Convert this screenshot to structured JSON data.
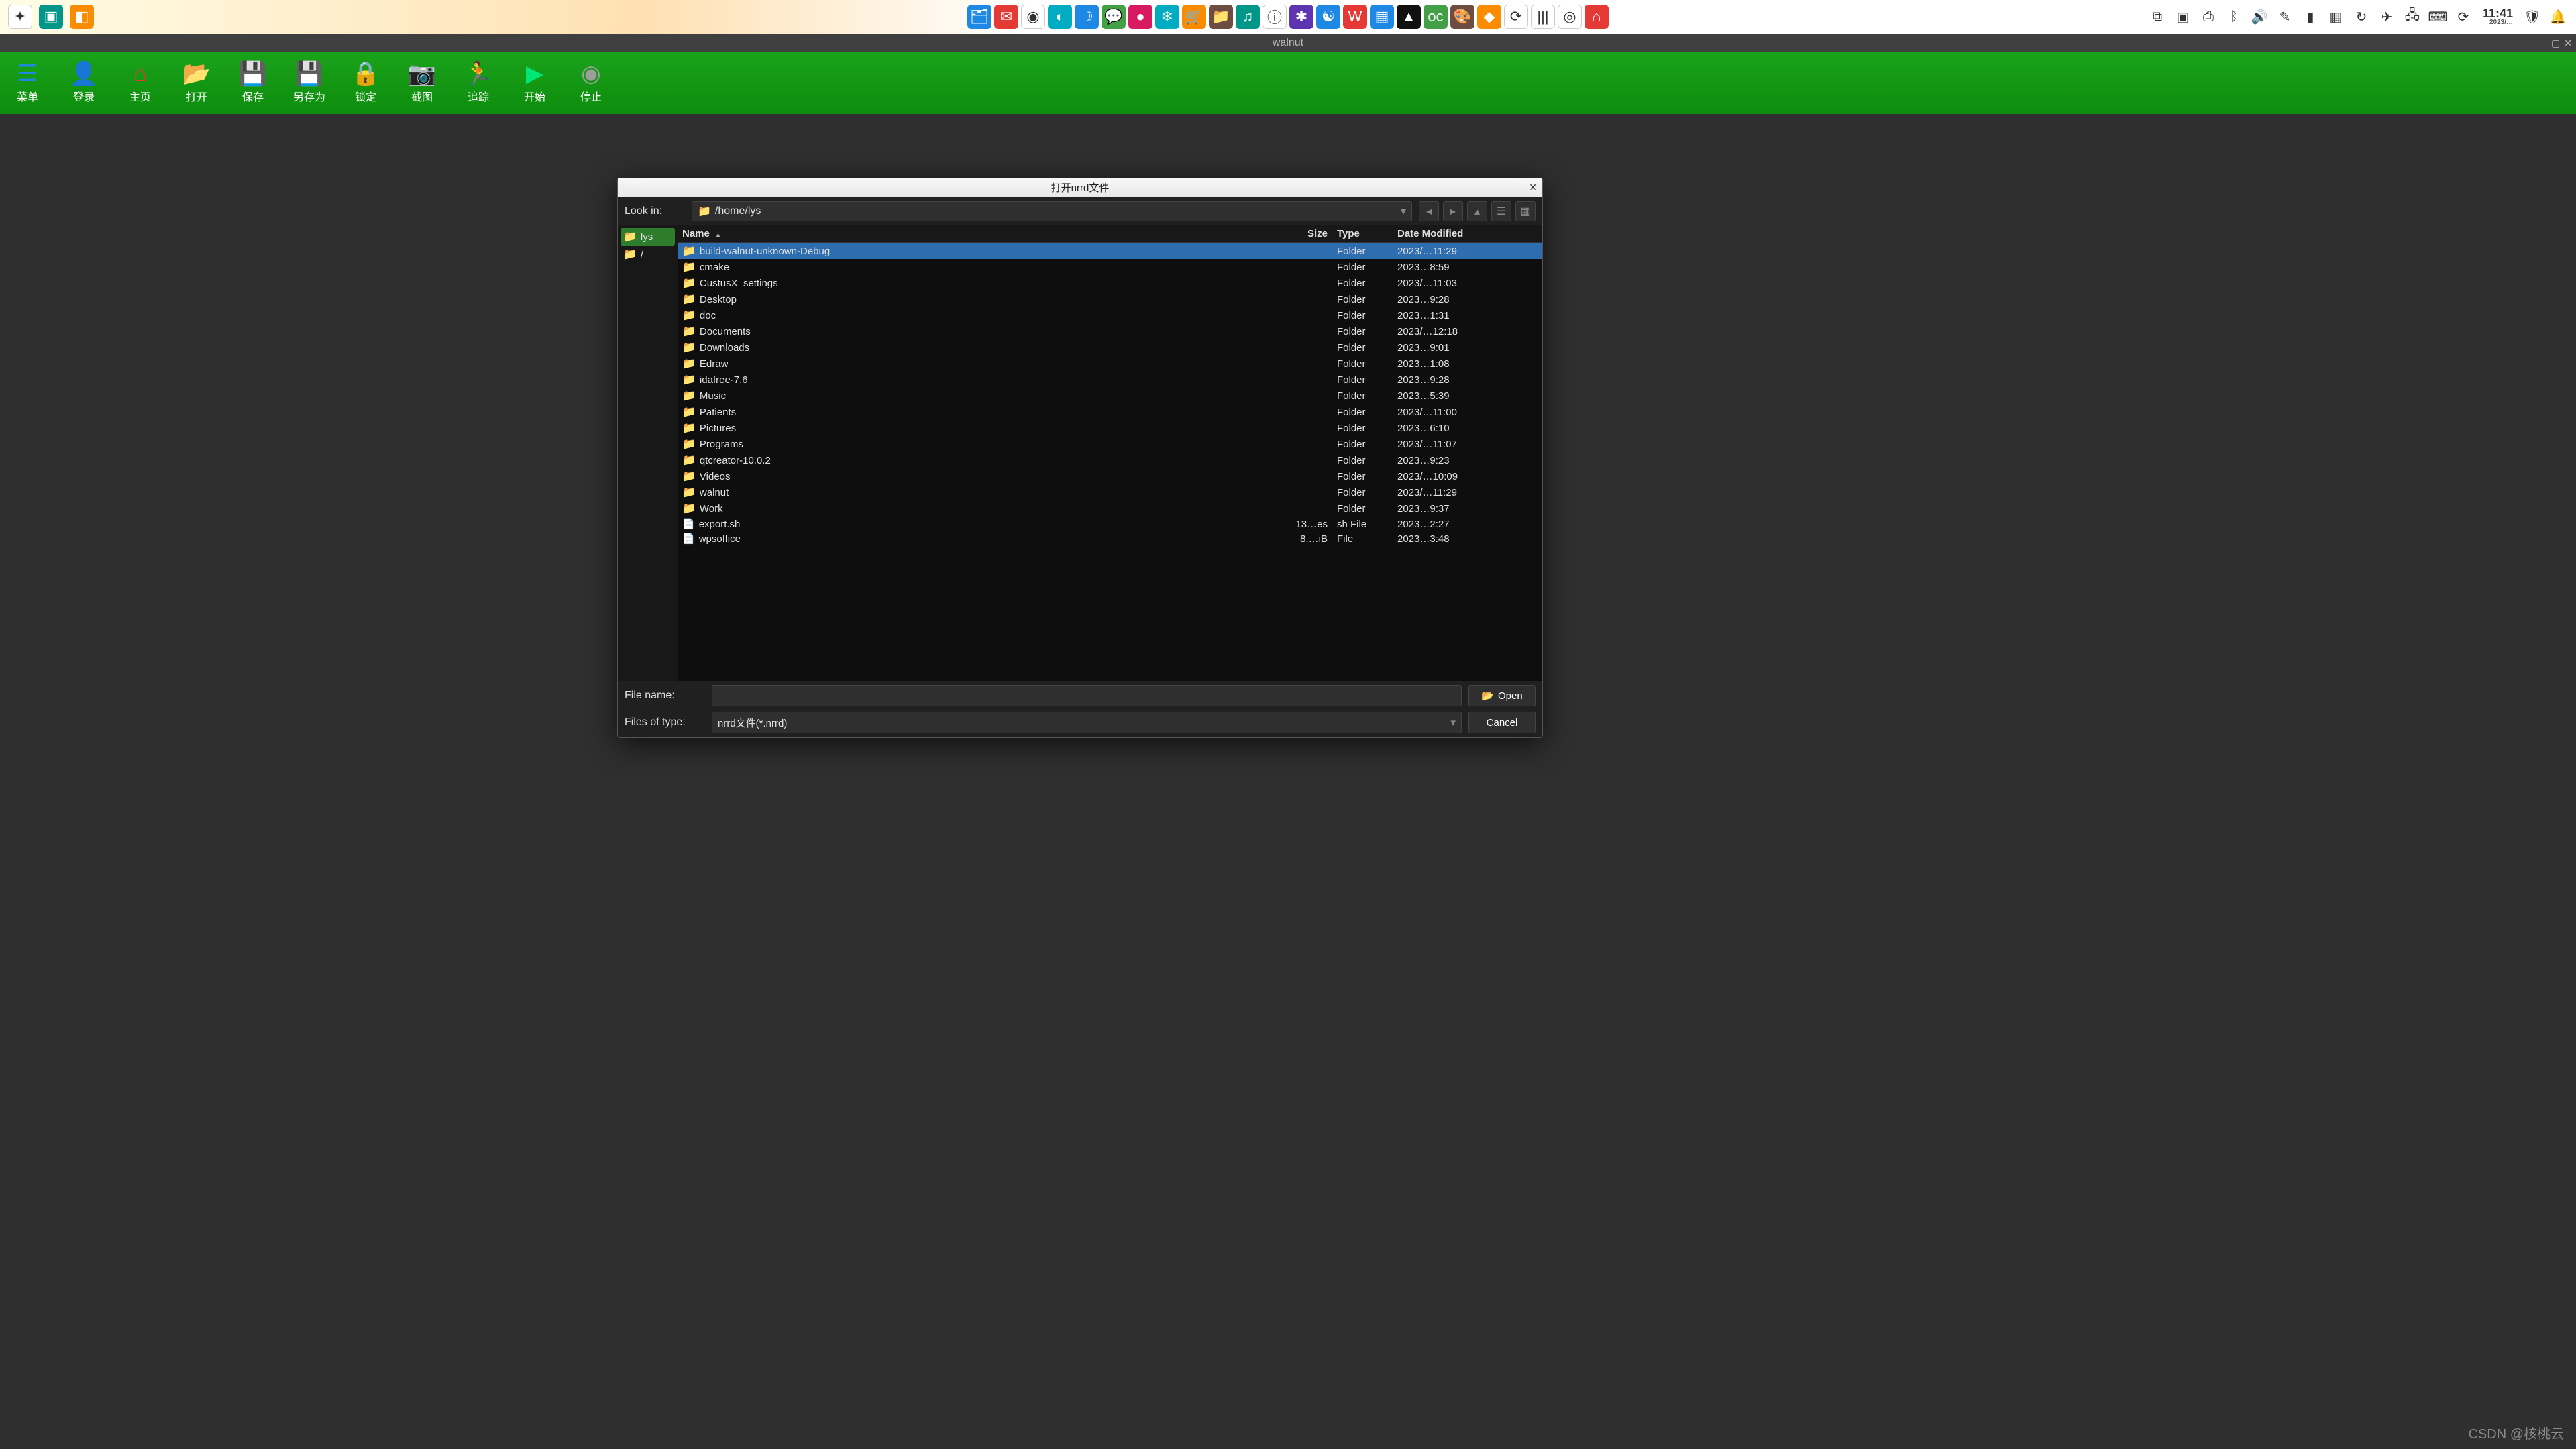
{
  "sysbar": {
    "clock_time": "11:41",
    "clock_meta": "2023/…"
  },
  "titlestrip": {
    "title": "walnut"
  },
  "toolbar": {
    "items": [
      {
        "label": "菜单"
      },
      {
        "label": "登录"
      },
      {
        "label": "主页"
      },
      {
        "label": "打开"
      },
      {
        "label": "保存"
      },
      {
        "label": "另存为"
      },
      {
        "label": "锁定"
      },
      {
        "label": "截图"
      },
      {
        "label": "追踪"
      },
      {
        "label": "开始"
      },
      {
        "label": "停止"
      }
    ]
  },
  "dialog": {
    "title": "打开nrrd文件",
    "lookin_label": "Look in:",
    "path": "/home/lys",
    "sidebar": [
      {
        "label": "lys",
        "selected": true
      },
      {
        "label": "/",
        "selected": false
      }
    ],
    "columns": {
      "name": "Name",
      "size": "Size",
      "type": "Type",
      "date": "Date Modified"
    },
    "rows": [
      {
        "name": "build-walnut-unknown-Debug",
        "size": "",
        "type": "Folder",
        "date": "2023/…11:29",
        "kind": "folder",
        "selected": true
      },
      {
        "name": "cmake",
        "size": "",
        "type": "Folder",
        "date": "2023…8:59",
        "kind": "folder"
      },
      {
        "name": "CustusX_settings",
        "size": "",
        "type": "Folder",
        "date": "2023/…11:03",
        "kind": "folder"
      },
      {
        "name": "Desktop",
        "size": "",
        "type": "Folder",
        "date": "2023…9:28",
        "kind": "folder"
      },
      {
        "name": "doc",
        "size": "",
        "type": "Folder",
        "date": "2023…1:31",
        "kind": "folder"
      },
      {
        "name": "Documents",
        "size": "",
        "type": "Folder",
        "date": "2023/…12:18",
        "kind": "folder"
      },
      {
        "name": "Downloads",
        "size": "",
        "type": "Folder",
        "date": "2023…9:01",
        "kind": "folder"
      },
      {
        "name": "Edraw",
        "size": "",
        "type": "Folder",
        "date": "2023…1:08",
        "kind": "folder"
      },
      {
        "name": "idafree-7.6",
        "size": "",
        "type": "Folder",
        "date": "2023…9:28",
        "kind": "folder"
      },
      {
        "name": "Music",
        "size": "",
        "type": "Folder",
        "date": "2023…5:39",
        "kind": "folder"
      },
      {
        "name": "Patients",
        "size": "",
        "type": "Folder",
        "date": "2023/…11:00",
        "kind": "folder"
      },
      {
        "name": "Pictures",
        "size": "",
        "type": "Folder",
        "date": "2023…6:10",
        "kind": "folder"
      },
      {
        "name": "Programs",
        "size": "",
        "type": "Folder",
        "date": "2023/…11:07",
        "kind": "folder"
      },
      {
        "name": "qtcreator-10.0.2",
        "size": "",
        "type": "Folder",
        "date": "2023…9:23",
        "kind": "folder"
      },
      {
        "name": "Videos",
        "size": "",
        "type": "Folder",
        "date": "2023/…10:09",
        "kind": "folder"
      },
      {
        "name": "walnut",
        "size": "",
        "type": "Folder",
        "date": "2023/…11:29",
        "kind": "folder"
      },
      {
        "name": "Work",
        "size": "",
        "type": "Folder",
        "date": "2023…9:37",
        "kind": "folder"
      },
      {
        "name": "export.sh",
        "size": "13…es",
        "type": "sh File",
        "date": "2023…2:27",
        "kind": "file"
      },
      {
        "name": "wpsoffice",
        "size": "8.…iB",
        "type": "File",
        "date": "2023…3:48",
        "kind": "file"
      }
    ],
    "filename_label": "File name:",
    "filename_value": "",
    "filetype_label": "Files of type:",
    "filetype_value": "nrrd文件(*.nrrd)",
    "open_label": "Open",
    "cancel_label": "Cancel"
  },
  "watermark": "CSDN @核桃云"
}
